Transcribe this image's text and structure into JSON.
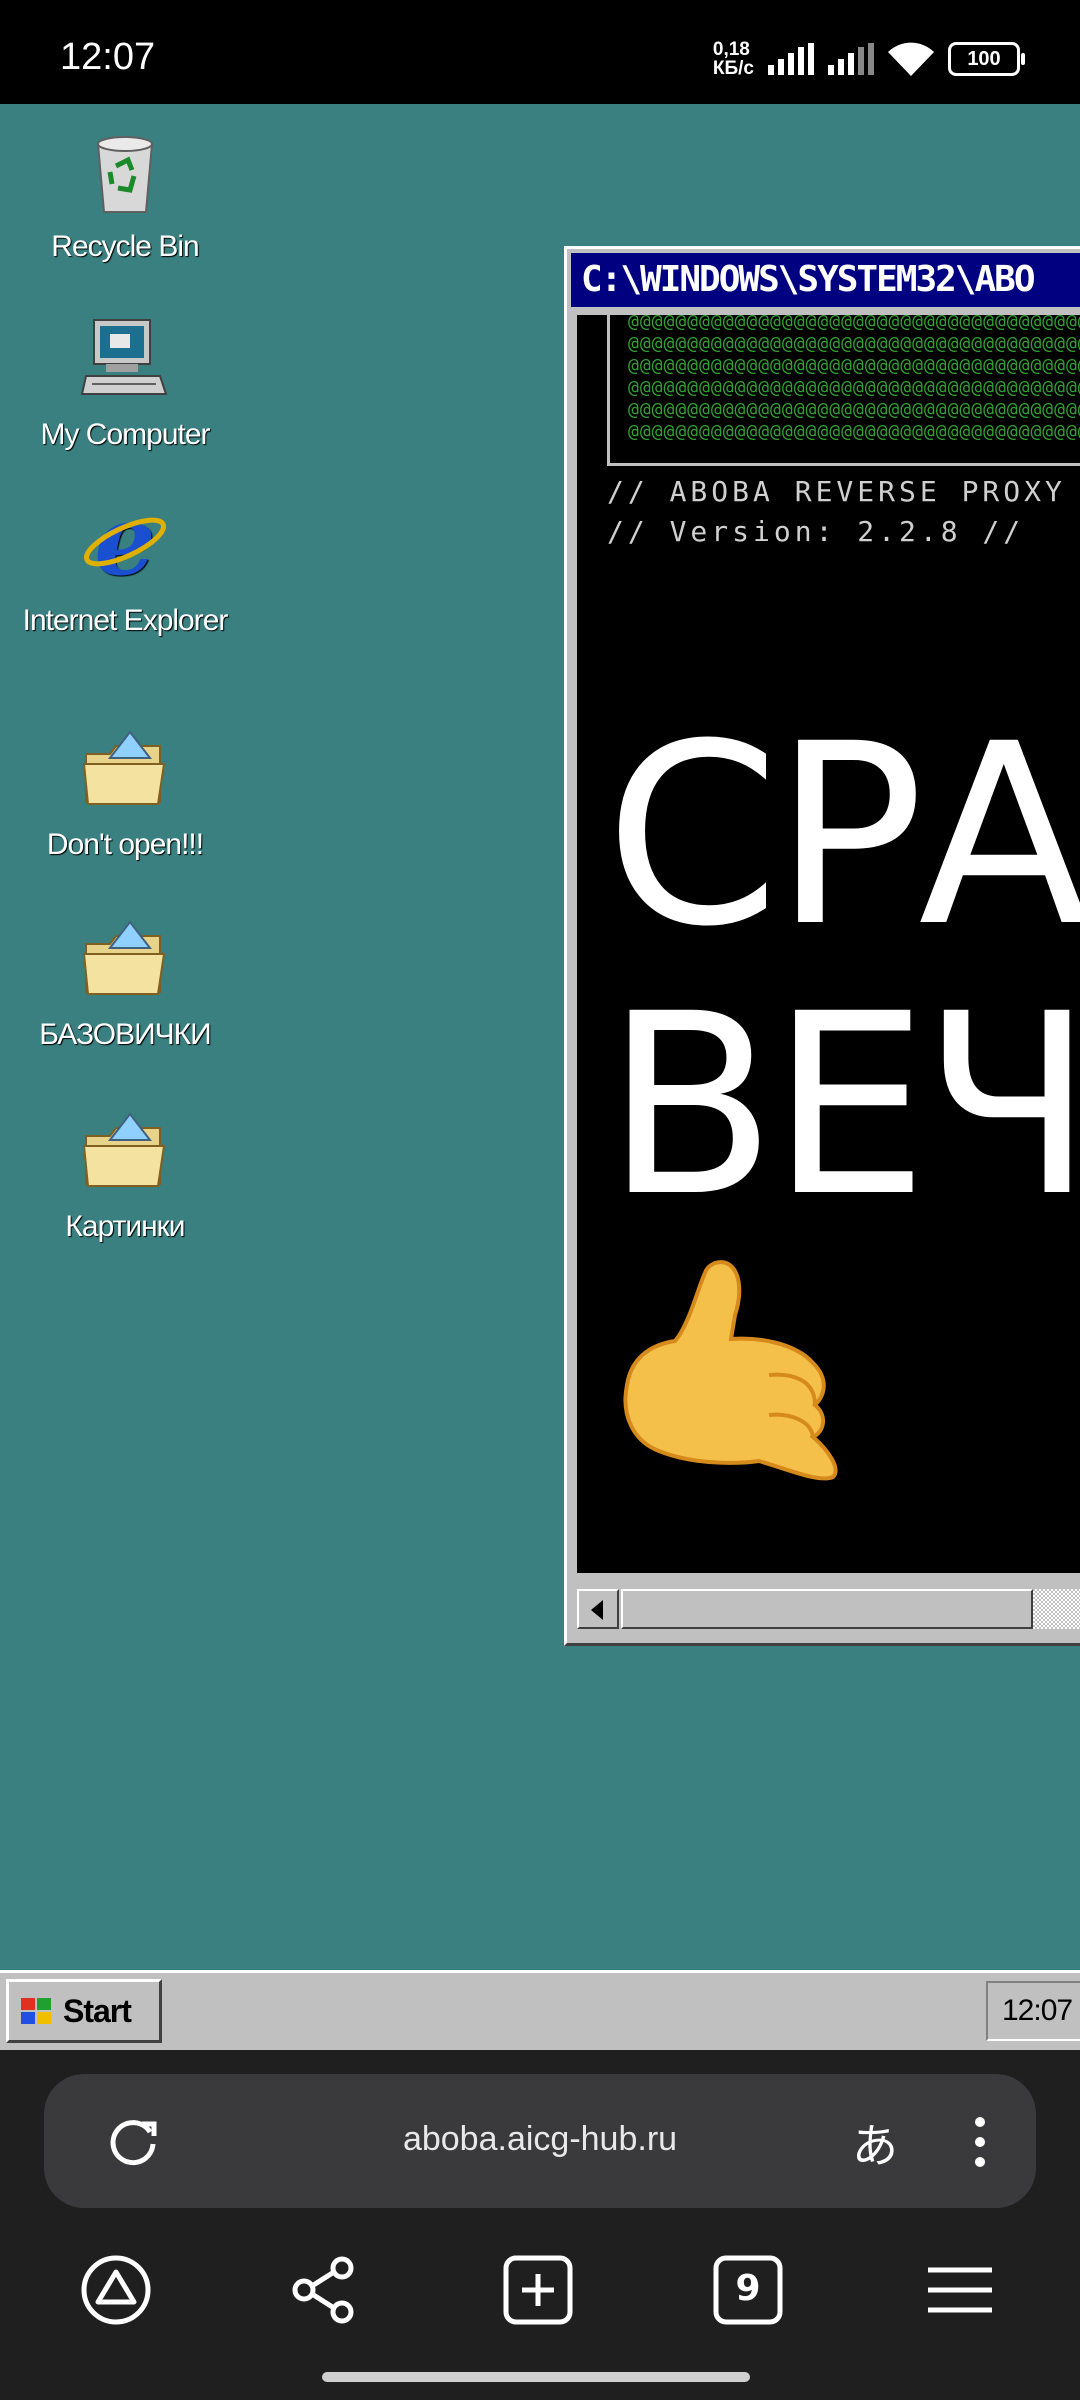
{
  "status_bar": {
    "time": "12:07",
    "net_speed_value": "0,18",
    "net_speed_unit": "КБ/с",
    "battery": "100"
  },
  "desktop": {
    "background": "#3a8080",
    "icons": [
      {
        "label": "Recycle Bin",
        "icon": "recycle-bin-icon"
      },
      {
        "label": "My Computer",
        "icon": "computer-icon"
      },
      {
        "label": "Internet Explorer",
        "icon": "internet-explorer-icon"
      },
      {
        "label": "Don't open!!!",
        "icon": "folder-icon"
      },
      {
        "label": "БАЗОВИЧКИ",
        "icon": "folder-icon"
      },
      {
        "label": "Картинки",
        "icon": "folder-icon"
      }
    ]
  },
  "console": {
    "title": "C:\\WINDOWS\\SYSTEM32\\ABO",
    "ascii_art": [
      "@@@@@@@@@@@@@@@@@@@@@@@@@@@@@@@@@@@@@@@@@",
      "@@@@@@@@@@@@@@@@@@@@@@@@@@@@@@@@@@@@@@@@@",
      "@@@@@@@@@@@@@@@@@@@@@@@@@@@@@@@@@@@@@@@@@",
      "@@@@@@@@@@@@@@@@@@@@@@@@@@@@@@@@@@@@@@@@@",
      "@@@@@@@@@@@@@@@@@@@@@@@@@@@@@@@@@@@@@@@@@",
      "@@@@@@@@@@@@@@@@@@@@@@@@@@@@@@@@@@@@@@@@@"
    ],
    "proxy_line": "// ABOBA REVERSE PROXY /",
    "version_line": "// Version: 2.2.8 //",
    "big_line_1": "СРАТ",
    "big_line_2": "ВЕЧН",
    "emoji": "call-me-hand"
  },
  "taskbar": {
    "start_label": "Start",
    "clock": "12:07"
  },
  "browser": {
    "url": "aboba.aicg-hub.ru",
    "translate_glyph": "あ",
    "tab_count": "9"
  }
}
